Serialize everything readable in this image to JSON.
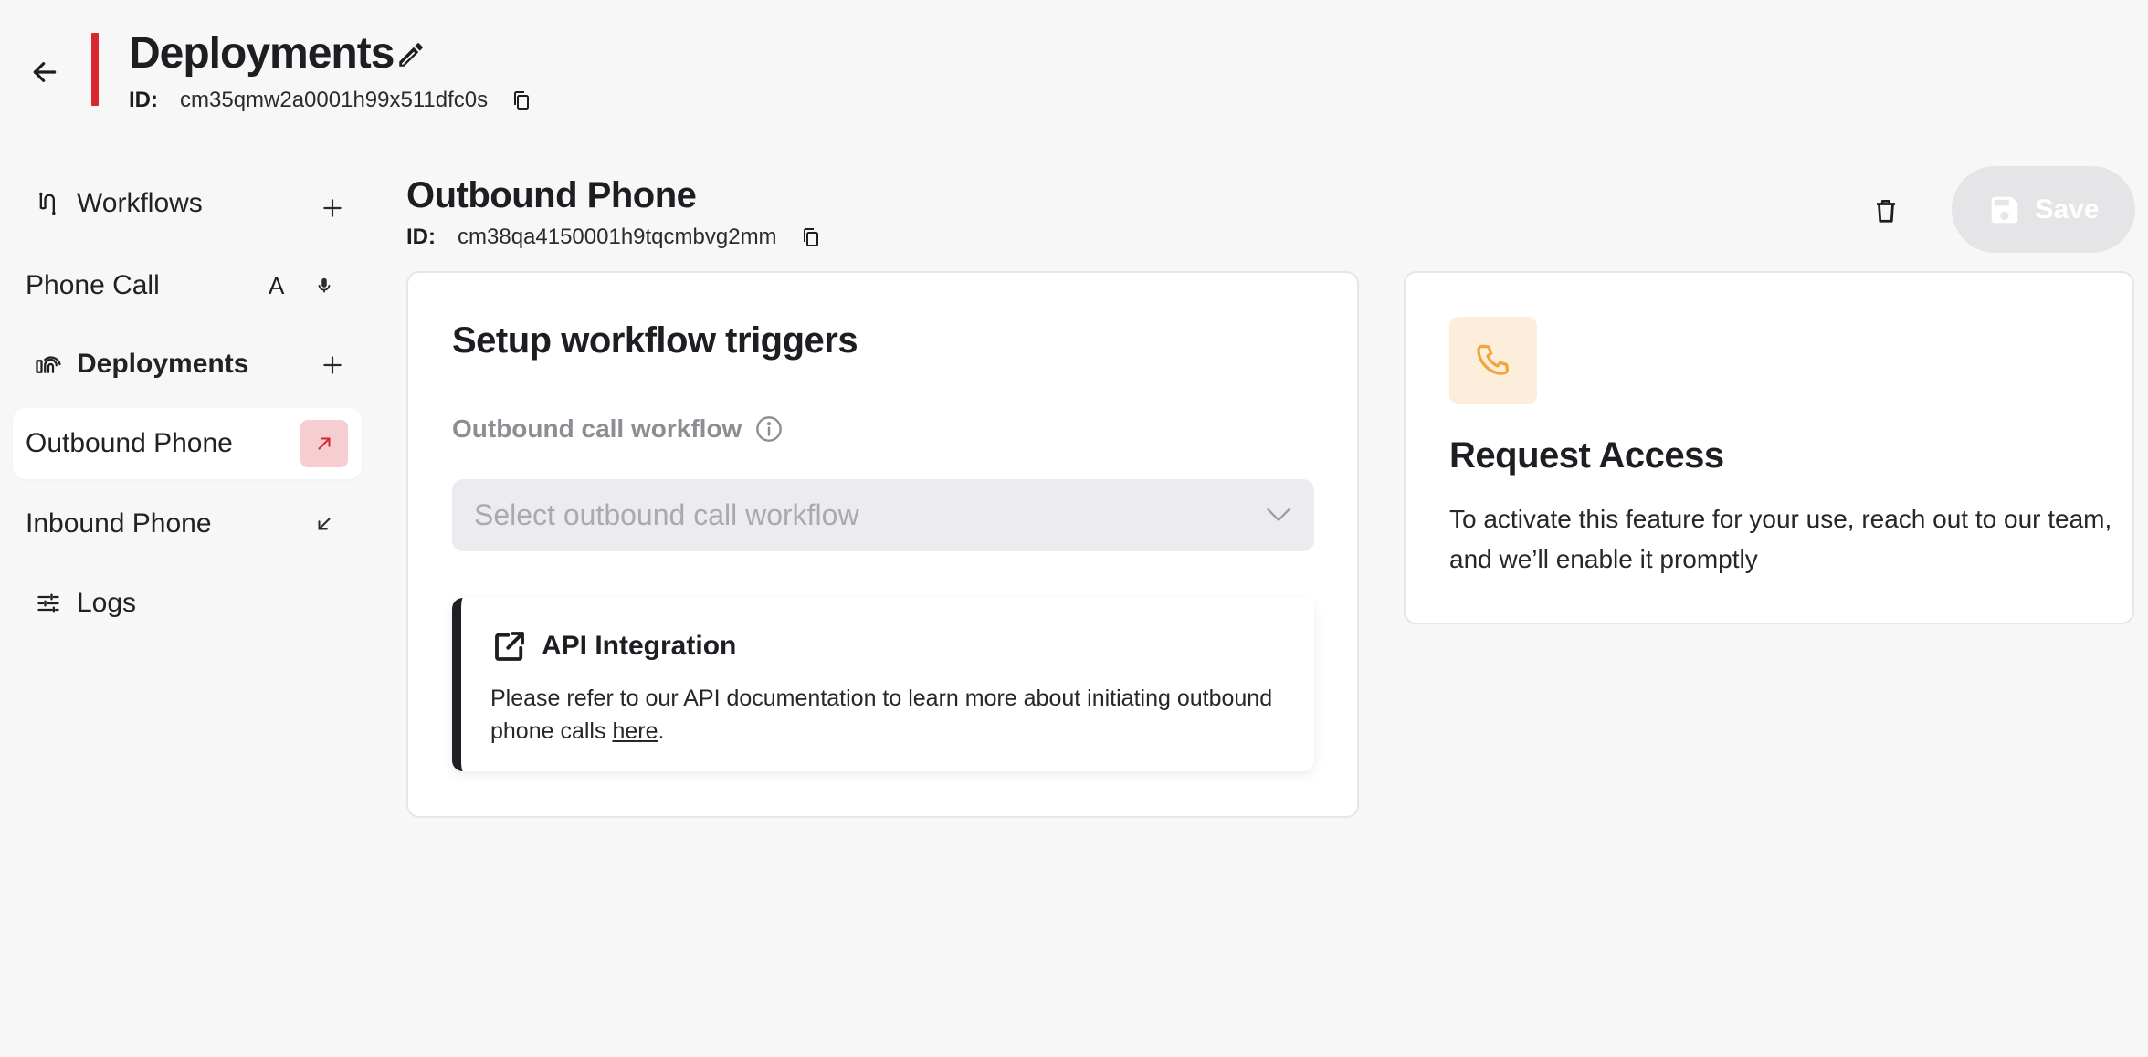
{
  "header": {
    "title": "Deployments",
    "id_label": "ID:",
    "id_value": "cm35qmw2a0001h99x511dfc0s"
  },
  "sidebar": {
    "workflows_label": "Workflows",
    "workflow_items": [
      {
        "label": "Phone Call",
        "badge": "A"
      }
    ],
    "deployments_label": "Deployments",
    "deployment_items": [
      {
        "label": "Outbound Phone",
        "icon": "arrow-up-right-icon",
        "active": true
      },
      {
        "label": "Inbound Phone",
        "icon": "arrow-down-left-icon",
        "active": false
      }
    ],
    "logs_label": "Logs"
  },
  "main": {
    "title": "Outbound Phone",
    "id_label": "ID:",
    "id_value": "cm38qa4150001h9tqcmbvg2mm",
    "save_label": "Save",
    "triggers_card": {
      "heading": "Setup workflow triggers",
      "field_label": "Outbound call workflow",
      "select_placeholder": "Select outbound call workflow",
      "api": {
        "title": "API Integration",
        "text": "Please refer to our API documentation to learn more about initiating outbound phone calls ",
        "link": "here",
        "suffix": "."
      }
    },
    "access_card": {
      "heading": "Request Access",
      "text": "To activate this feature for your use, reach out to our team, and we’ll enable it promptly"
    }
  },
  "colors": {
    "accent": "#d9272e",
    "active_badge_bg": "#f6cdd0",
    "phone_tile_bg": "#fdeedb",
    "phone_icon": "#f0a63c",
    "save_bg": "#e5e5e7"
  }
}
